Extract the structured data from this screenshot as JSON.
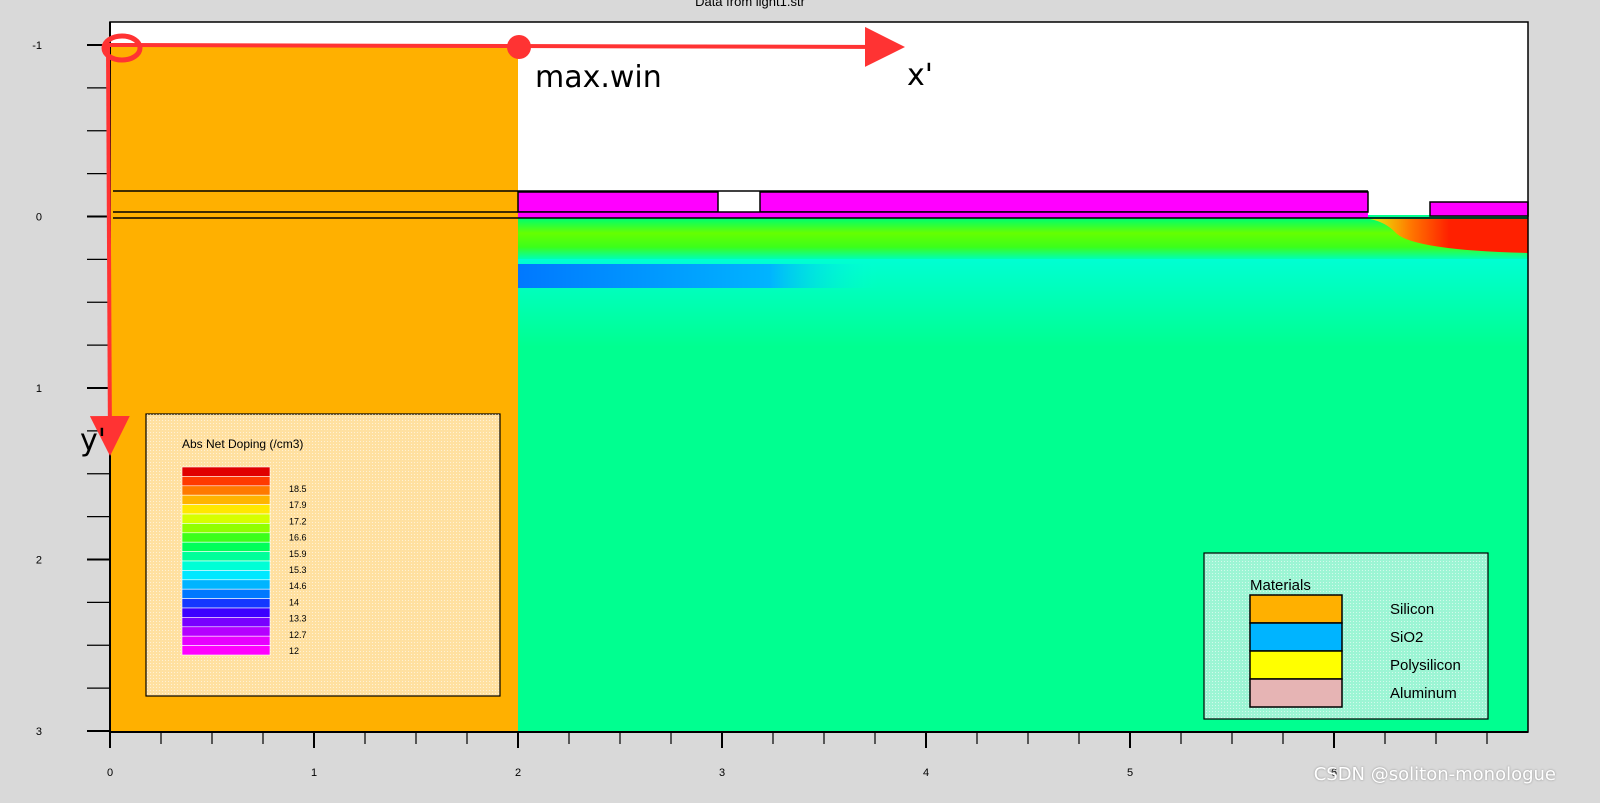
{
  "chart_data": {
    "type": "heatmap",
    "title": "Data from light1.str",
    "x_ticks": [
      "0",
      "1",
      "2",
      "3",
      "4",
      "5",
      "6"
    ],
    "y_ticks": [
      "-1",
      "0",
      "1",
      "2",
      "3"
    ],
    "xlim": [
      0,
      7
    ],
    "ylim": [
      -1,
      3
    ],
    "y_axis_direction": "down",
    "legend_doping": {
      "title": "Abs Net Doping (/cm3)",
      "values": [
        "18.5",
        "17.9",
        "17.2",
        "16.6",
        "15.9",
        "15.3",
        "14.6",
        "14",
        "13.3",
        "12.7",
        "12"
      ],
      "colors": [
        "#e00000",
        "#ff3a00",
        "#ff7a00",
        "#ffb400",
        "#ffe800",
        "#d6ff00",
        "#90ff00",
        "#3cff1a",
        "#00ff5a",
        "#00ff9a",
        "#00ffd6",
        "#00e8ff",
        "#00b4ff",
        "#0078ff",
        "#1438ff",
        "#3c00ff",
        "#7800ff",
        "#b400ff",
        "#e600ff",
        "#ff00ff"
      ]
    },
    "legend_materials": {
      "title": "Materials",
      "items": [
        {
          "name": "Silicon",
          "color": "#ffb000"
        },
        {
          "name": "SiO2",
          "color": "#00b4ff"
        },
        {
          "name": "Polysilicon",
          "color": "#ffff00"
        },
        {
          "name": "Aluminum",
          "color": "#e6b4b4"
        }
      ]
    },
    "regions": {
      "silicon_block": {
        "x": [
          0,
          2
        ],
        "y": [
          -1,
          3
        ],
        "color": "#ffb000"
      },
      "doped_background": {
        "x": [
          2,
          7
        ],
        "y": [
          0,
          3
        ],
        "color": "#00ff90"
      },
      "top_dielectric_layers_y": [
        -0.16,
        -0.04,
        0
      ],
      "magenta_segments_x": [
        [
          2,
          3
        ],
        [
          3.2,
          6.2
        ],
        [
          6.5,
          7
        ]
      ],
      "magenta_color": "#ff00ff",
      "bands": [
        {
          "name": "surface-green-band",
          "x": [
            2,
            7
          ],
          "y": [
            0,
            0.2
          ],
          "color": "#66ff00"
        },
        {
          "name": "blue-implant",
          "x": [
            2,
            4.0
          ],
          "y": [
            0.26,
            0.38
          ],
          "color": "#0078ff"
        },
        {
          "name": "cyan-transition",
          "x": [
            2,
            7
          ],
          "y": [
            0.38,
            0.75
          ],
          "color": "#00ffb4"
        },
        {
          "name": "red-contact",
          "x": [
            6.3,
            7
          ],
          "y": [
            0,
            0.1
          ],
          "color": "#ff2000"
        }
      ]
    }
  },
  "annotations": {
    "max_win": "max.win",
    "x_prime": "x'",
    "y_prime": "y'",
    "arrow_color": "#ff3333"
  },
  "watermark": "CSDN @soliton-monologue"
}
